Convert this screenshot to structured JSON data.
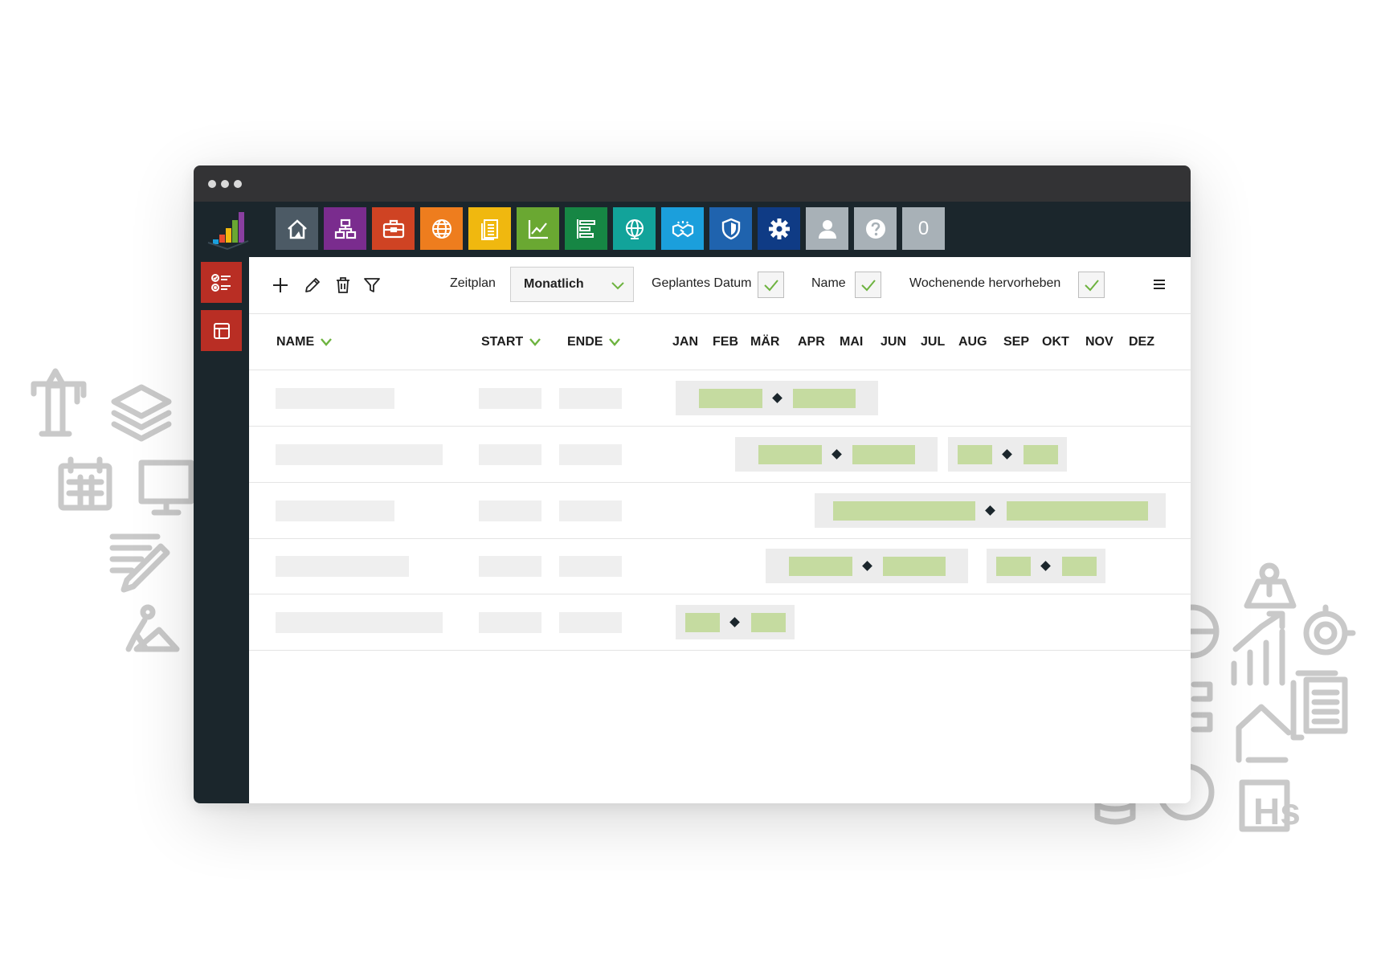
{
  "app_tiles": [
    {
      "icon": "home-icon",
      "color": "#4c5a65"
    },
    {
      "icon": "org-chart-icon",
      "color": "#7a2c8e"
    },
    {
      "icon": "briefcase-icon",
      "color": "#cf4323"
    },
    {
      "icon": "globe-icon",
      "color": "#ee7d1e"
    },
    {
      "icon": "document-icon",
      "color": "#f0b80f"
    },
    {
      "icon": "line-chart-icon",
      "color": "#6aa832"
    },
    {
      "icon": "gantt-icon",
      "color": "#168644"
    },
    {
      "icon": "globe-monitor-icon",
      "color": "#12a39a"
    },
    {
      "icon": "handshake-icon",
      "color": "#1b9fdc"
    },
    {
      "icon": "shield-icon",
      "color": "#1f63ae"
    },
    {
      "icon": "gear-icon",
      "color": "#0f3b85"
    },
    {
      "icon": "user-icon",
      "color": "#a8b1b7"
    },
    {
      "icon": "help-icon",
      "color": "#a8b1b7"
    },
    {
      "icon": "counter-badge",
      "color": "#a8b1b7"
    }
  ],
  "notification_count": "0",
  "sidebar": [
    {
      "icon": "task-list-icon"
    },
    {
      "icon": "layout-icon"
    }
  ],
  "toolbar": {
    "actions": [
      "add-icon",
      "edit-icon",
      "delete-icon",
      "filter-icon"
    ],
    "schedule_label": "Zeitplan",
    "schedule_value": "Monatlich",
    "planned_date_label": "Geplantes Datum",
    "planned_date_checked": true,
    "name_label": "Name",
    "name_checked": true,
    "weekend_label": "Wochenende hervorheben",
    "weekend_checked": true
  },
  "columns": {
    "name": "NAME",
    "start": "START",
    "end": "ENDE",
    "months": [
      "JAN",
      "FEB",
      "MÄR",
      "APR",
      "MAI",
      "JUN",
      "JUL",
      "AUG",
      "SEP",
      "OKT",
      "NOV",
      "DEZ"
    ]
  },
  "accent_color": "#6db33f",
  "bar_color": "#c5dba0"
}
